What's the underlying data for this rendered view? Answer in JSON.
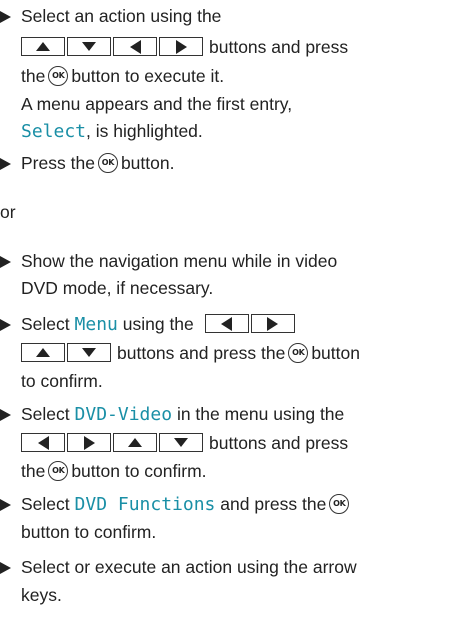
{
  "steps": {
    "s1": {
      "line1": "Select an action using the",
      "after_keys": "buttons and press",
      "line3_pre": "the",
      "line3_post": "button to execute it.",
      "line4": "A menu appears and the first entry,",
      "term": "Select",
      "line5_post": ", is highlighted."
    },
    "s2": {
      "pre": "Press the",
      "post": "button."
    },
    "or": "or",
    "s3": {
      "line1": "Show the navigation menu while in video",
      "line2": "DVD mode, if necessary."
    },
    "s4": {
      "pre": "Select",
      "term": "Menu",
      "mid": "using the",
      "line2_post": "buttons and press the",
      "line2_end": "button",
      "line3": "to confirm."
    },
    "s5": {
      "pre": "Select",
      "term": "DVD-Video",
      "post": "in the menu using the",
      "line2_post": "buttons and press",
      "line3_pre": "the",
      "line3_post": "button to confirm."
    },
    "s6": {
      "pre": "Select",
      "term": "DVD Functions",
      "post": "and press the",
      "line2": "button to confirm."
    },
    "s7": {
      "line1": "Select or execute an action using the arrow",
      "line2": "keys."
    }
  },
  "keys": {
    "ok_label": "OK"
  },
  "icons": {
    "up": "arrow-up-icon",
    "down": "arrow-down-icon",
    "left": "arrow-left-icon",
    "right": "arrow-right-icon",
    "ok": "ok-button-icon",
    "bullet": "bullet-triangle-icon"
  },
  "colors": {
    "text": "#222222",
    "term": "#1a8fa6"
  }
}
